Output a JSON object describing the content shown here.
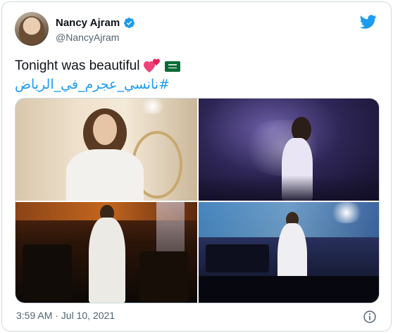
{
  "author": {
    "name": "Nancy Ajram",
    "handle": "@NancyAjram",
    "verified": true,
    "avatar_icon": "profile-photo"
  },
  "tweet": {
    "text": "Tonight was beautiful",
    "emojis": [
      "two-hearts-emoji",
      "saudi-flag-emoji"
    ],
    "hashtag": "#نانسي_عجرم_في_الرياض"
  },
  "media": {
    "photos": [
      {
        "name": "photo-white-dress-portrait"
      },
      {
        "name": "photo-singing-purple-stage"
      },
      {
        "name": "photo-stage-orchestra-orange"
      },
      {
        "name": "photo-stage-band-blue"
      }
    ]
  },
  "footer": {
    "timestamp": "3:59 AM · Jul 10, 2021",
    "info_icon": "info-icon"
  },
  "colors": {
    "brand_blue": "#1d9bf0",
    "secondary_text": "#536471",
    "border": "#cfd9de"
  }
}
